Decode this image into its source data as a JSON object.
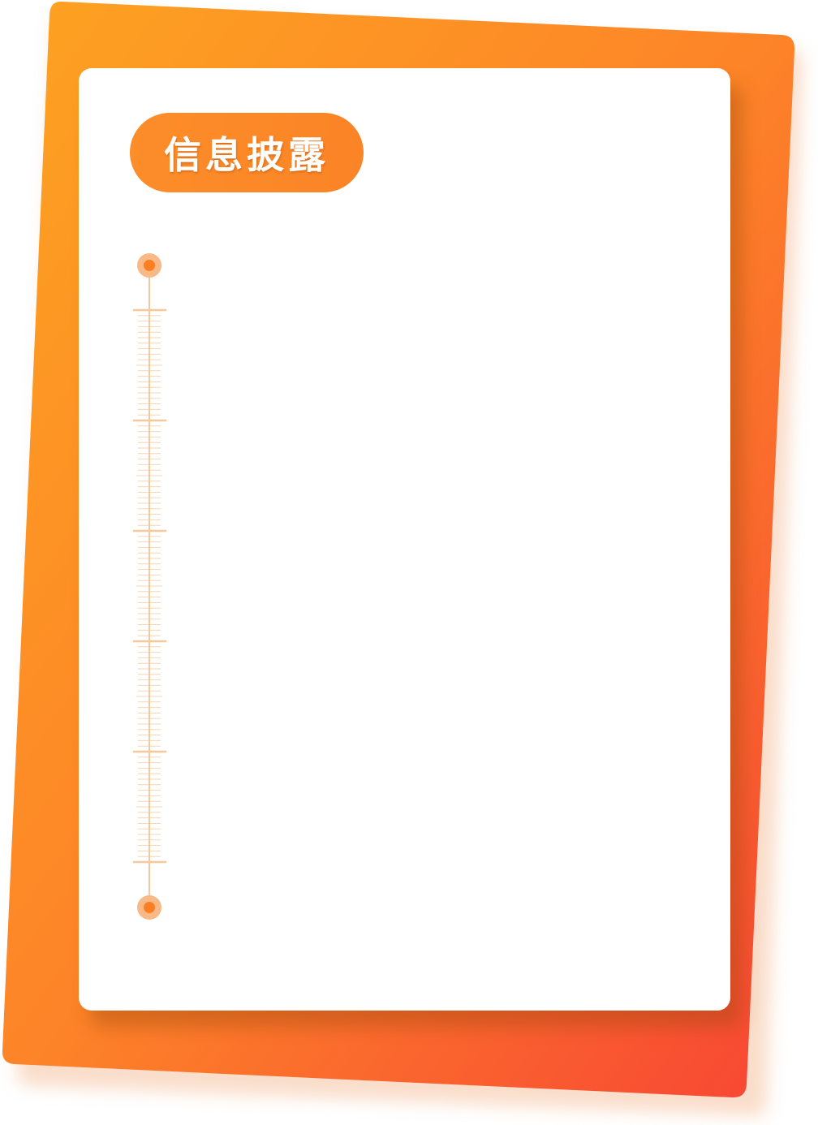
{
  "header": {
    "title": "信息披露"
  },
  "theme": {
    "gradient_start": "#fda321",
    "gradient_mid": "#fd8428",
    "gradient_end": "#f74534",
    "ruler_color": "#f9c79a",
    "dot_outer": "#f9b987",
    "dot_inner": "#fb7f22",
    "card_color": "#ffffff"
  },
  "decor": {
    "timeline_end_icons": [
      "timeline-dot-icon",
      "timeline-dot-icon"
    ]
  }
}
